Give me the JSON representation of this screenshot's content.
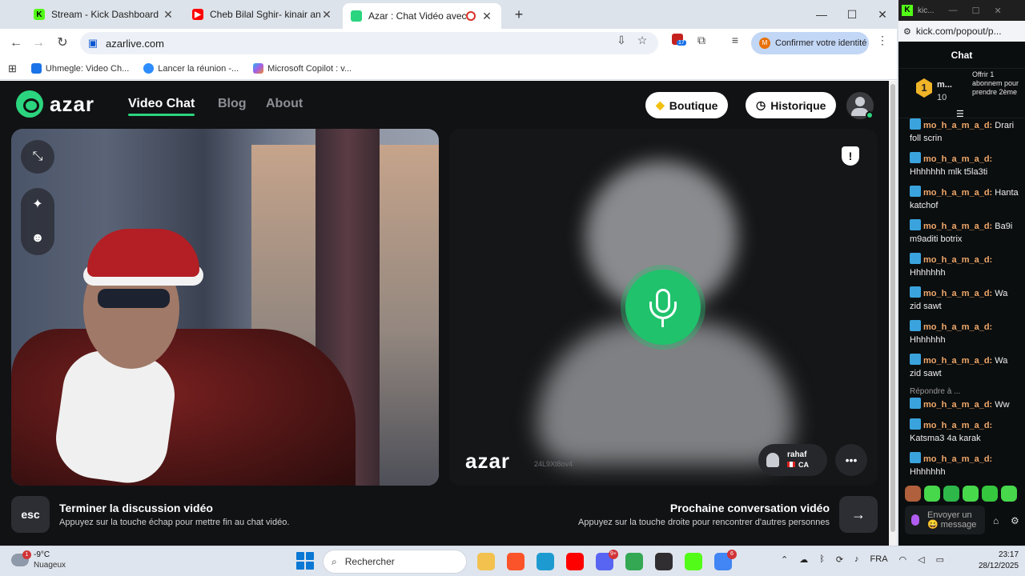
{
  "browser": {
    "tabs": [
      {
        "title": "Stream - Kick Dashboard",
        "favicon": "kick-icon",
        "color": "#53fc18"
      },
      {
        "title": "Cheb Bilal Sghir- kinair ana - Yo",
        "favicon": "youtube-icon",
        "color": "#ff0000"
      },
      {
        "title": "Azar : Chat Vidéo avec de n",
        "favicon": "azar-icon",
        "color": "#2bd47e"
      }
    ],
    "new_tab": "+",
    "window_controls": {
      "minimize": "—",
      "maximize": "☐",
      "close": "✕"
    },
    "url": "azarlive.com",
    "identity_button": "Confirmer votre identité",
    "identity_initial": "M",
    "extension_badge": "17",
    "bookmarks": [
      {
        "label": "Uhmegle: Video Ch...",
        "color": "#1a73e8"
      },
      {
        "label": "Lancer la réunion -...",
        "color": "#2d8cff"
      },
      {
        "label": "Microsoft Copilot : v...",
        "color": "#a35ee8"
      }
    ]
  },
  "azar": {
    "logo_text": "azar",
    "nav": {
      "video_chat": "Video Chat",
      "blog": "Blog",
      "about": "About"
    },
    "shop_button": "Boutique",
    "history_button": "Historique",
    "remote": {
      "watermark": "azar",
      "session_id": "24L9Xt8ov4",
      "username": "rahaf",
      "country": "CA"
    },
    "end_hint": {
      "key": "esc",
      "title": "Terminer la discussion vidéo",
      "subtitle": "Appuyez sur la touche échap pour mettre fin au chat vidéo."
    },
    "next_hint": {
      "key": "→",
      "title": "Prochaine conversation vidéo",
      "subtitle": "Appuyez sur la touche droite pour rencontrer d'autres personnes"
    },
    "colors": {
      "accent": "#20c26c",
      "background": "#111214"
    }
  },
  "kick": {
    "window_title": "kic...",
    "url": "kick.com/popout/p...",
    "chat_title": "Chat",
    "pinned": {
      "rank": "1",
      "name": "m...",
      "count": "10",
      "offer": "Offrir 1 abonnem pour prendre 2ème"
    },
    "messages": [
      {
        "user": "mo_h_a_m_a_d:",
        "text": "Drari foll scrin"
      },
      {
        "user": "mo_h_a_m_a_d:",
        "text": "Hhhhhhh mlk t5la3ti"
      },
      {
        "user": "mo_h_a_m_a_d:",
        "text": "Hanta katchof"
      },
      {
        "user": "mo_h_a_m_a_d:",
        "text": "Ba9i m9aditi botrix"
      },
      {
        "user": "mo_h_a_m_a_d:",
        "text": "Hhhhhhh"
      },
      {
        "user": "mo_h_a_m_a_d:",
        "text": "Wa zid sawt"
      },
      {
        "user": "mo_h_a_m_a_d:",
        "text": "Hhhhhhh"
      },
      {
        "user": "mo_h_a_m_a_d:",
        "text": "Wa zid sawt"
      },
      {
        "user": "mo_h_a_m_a_d:",
        "text": "Ww",
        "reply": "Répondre à ..."
      },
      {
        "user": "mo_h_a_m_a_d:",
        "text": "Katsma3 4a karak"
      },
      {
        "user": "mo_h_a_m_a_d:",
        "text": "Hhhhhhh"
      }
    ],
    "input_placeholder": "Envoyer un 😀 message",
    "accent": "#53fc18"
  },
  "taskbar": {
    "weather_badge": "1",
    "temperature": "-9°C",
    "condition": "Nuageux",
    "search_placeholder": "Rechercher",
    "apps": [
      {
        "icon": "file-explorer-icon",
        "color": "#f2c14e"
      },
      {
        "icon": "brave-icon",
        "color": "#fb542b"
      },
      {
        "icon": "edge-icon",
        "color": "#1d9bd1"
      },
      {
        "icon": "youtube-icon",
        "color": "#ff0000"
      },
      {
        "icon": "discord-icon",
        "color": "#5865f2",
        "badge": "9+"
      },
      {
        "icon": "chrome-icon",
        "color": "#34a853"
      },
      {
        "icon": "obs-icon",
        "color": "#302e31"
      },
      {
        "icon": "kick-icon",
        "color": "#53fc18"
      },
      {
        "icon": "chrome-profile-icon",
        "color": "#4285f4",
        "badge": "6"
      }
    ],
    "language": "FRA",
    "time": "23:17",
    "date": "28/12/2025"
  }
}
